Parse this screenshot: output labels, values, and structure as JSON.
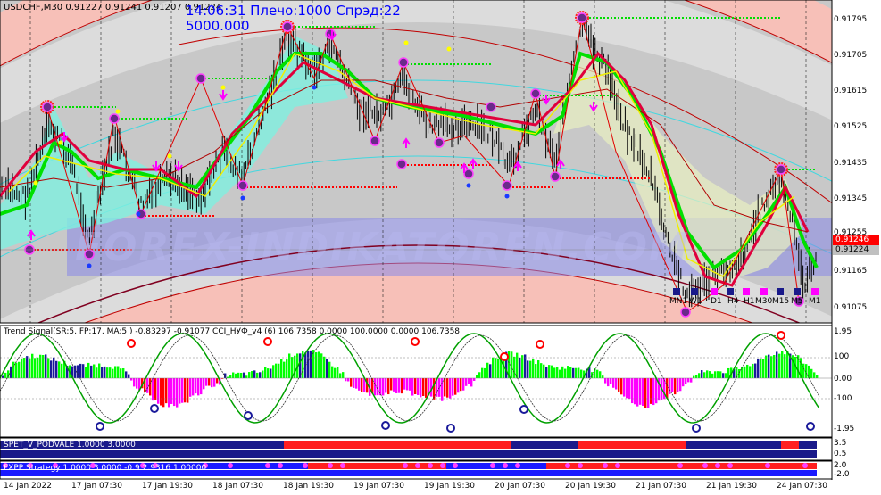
{
  "header": {
    "symbol_line": "USDCHF,M30  0.91227 0.91241 0.91207 0.91224",
    "info_line": "14:06:31 Плечо:1000 Спрэд:22",
    "balance": "5000.000"
  },
  "watermark": "FOREX-INDIKATOREN.COM",
  "price_axis": [
    "0.91795",
    "0.91705",
    "0.91615",
    "0.91525",
    "0.91435",
    "0.91345",
    "0.91255",
    "0.91165",
    "0.91075"
  ],
  "price_tags": {
    "red": "0.91246",
    "gray": "0.91224"
  },
  "timeframes": [
    "MN1",
    "W1",
    "D1",
    "H4",
    "H1",
    "M30",
    "M15",
    "M5",
    "M1"
  ],
  "indicator_panel": {
    "title": "Trend Signal(SR:5, FP:17, MA:5 ) -0.83297 -0.91077  CCI_НУФ_v4 (6) 106.7358 0.0000 100.0000 0.0000 106.7358",
    "scale": [
      "1.95",
      "100",
      "0.00",
      "-100",
      "-1.95"
    ]
  },
  "strip1": {
    "title": "SPET_V_PODVALE 1.0000 3.0000",
    "scale": [
      "3.5",
      "0.5"
    ]
  },
  "strip2": {
    "title": "FXPP Strategy  1.0000 3.0000 -0.9  2.9316 1.00000",
    "scale": [
      "2.0",
      "-2.0"
    ]
  },
  "time_axis": [
    "14 Jan 2022",
    "17 Jan 07:30",
    "17 Jan 19:30",
    "18 Jan 07:30",
    "18 Jan 19:30",
    "19 Jan 07:30",
    "19 Jan 19:30",
    "20 Jan 07:30",
    "20 Jan 19:30",
    "21 Jan 07:30",
    "21 Jan 19:30",
    "24 Jan 07:30"
  ],
  "colors": {
    "background": "#c8c8c8",
    "bull_band": "#00e000",
    "bear_line": "#e0003c",
    "signal_up": "#ff00ff",
    "level_green": "#00dd00",
    "level_red": "#ff0000",
    "hist_green": "#00ff00",
    "hist_magenta": "#ff00ff",
    "hist_navy": "#1a1a9a"
  }
}
